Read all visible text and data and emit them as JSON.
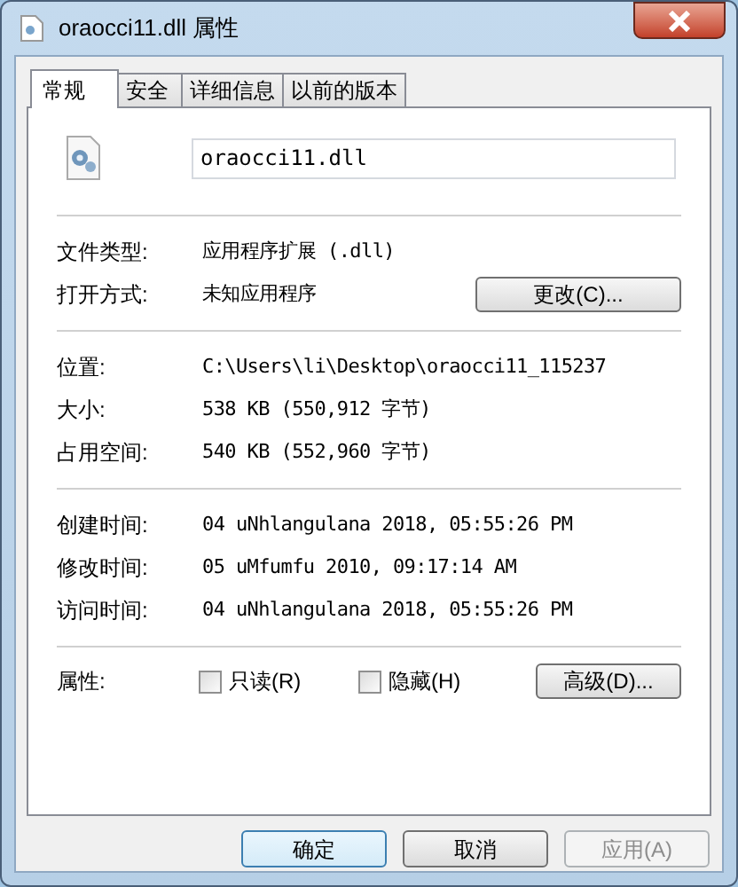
{
  "window": {
    "title": "oraocci11.dll 属性"
  },
  "tabs": [
    {
      "label": "常规",
      "selected": true
    },
    {
      "label": "安全",
      "selected": false
    },
    {
      "label": "详细信息",
      "selected": false
    },
    {
      "label": "以前的版本",
      "selected": false
    }
  ],
  "file_name": {
    "value": "oraocci11.dll"
  },
  "sections": [
    {
      "rows": [
        {
          "label": "文件类型:",
          "value": "应用程序扩展 (.dll)"
        },
        {
          "label": "打开方式:",
          "value": "未知应用程序",
          "button": "更改(C)..."
        }
      ]
    },
    {
      "rows": [
        {
          "label": "位置:",
          "value": "C:\\Users\\li\\Desktop\\oraocci11_115237"
        },
        {
          "label": "大小:",
          "value": "538 KB (550,912 字节)"
        },
        {
          "label": "占用空间:",
          "value": "540 KB (552,960 字节)"
        }
      ]
    },
    {
      "rows": [
        {
          "label": "创建时间:",
          "value": "04 uNhlangulana 2018, 05:55:26 PM"
        },
        {
          "label": "修改时间:",
          "value": "05 uMfumfu 2010, 09:17:14 AM"
        },
        {
          "label": "访问时间:",
          "value": "04 uNhlangulana 2018, 05:55:26 PM"
        }
      ]
    }
  ],
  "attributes": {
    "label": "属性:",
    "checkboxes": [
      {
        "label": "只读(R)",
        "checked": false
      },
      {
        "label": "隐藏(H)",
        "checked": false
      }
    ],
    "button": "高级(D)..."
  },
  "buttons": [
    {
      "label": "确定",
      "disabled": false
    },
    {
      "label": "取消",
      "disabled": false
    },
    {
      "label": "应用(A)",
      "disabled": true
    }
  ]
}
